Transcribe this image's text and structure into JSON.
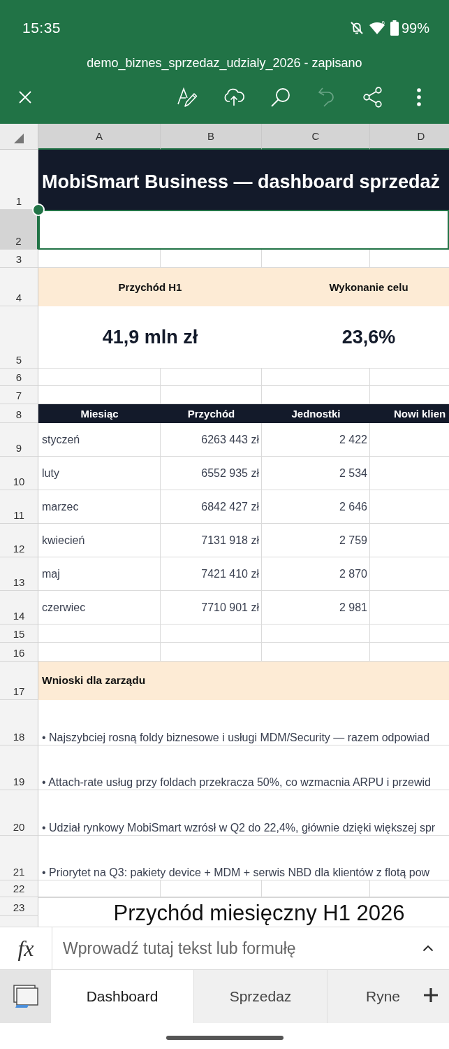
{
  "status_bar": {
    "time": "15:35",
    "wifi_label": "6",
    "battery": "99%"
  },
  "title_bar": {
    "document": "demo_biznes_sprzedaz_udzialy_2026 - zapisano"
  },
  "toolbar": {
    "undo": {
      "disabled": true
    }
  },
  "sheet": {
    "columns": [
      {
        "label": "A",
        "selected": true
      },
      {
        "label": "B",
        "selected": true
      },
      {
        "label": "C",
        "selected": true
      },
      {
        "label": "D",
        "selected": true
      }
    ],
    "rows": [
      {
        "label": "1",
        "selected": false
      },
      {
        "label": "2",
        "selected": true
      },
      {
        "label": "3",
        "selected": false
      },
      {
        "label": "4",
        "selected": false
      },
      {
        "label": "5",
        "selected": false
      },
      {
        "label": "6",
        "selected": false
      },
      {
        "label": "7",
        "selected": false
      },
      {
        "label": "8",
        "selected": false
      },
      {
        "label": "9",
        "selected": false
      },
      {
        "label": "10",
        "selected": false
      },
      {
        "label": "11",
        "selected": false
      },
      {
        "label": "12",
        "selected": false
      },
      {
        "label": "13",
        "selected": false
      },
      {
        "label": "14",
        "selected": false
      },
      {
        "label": "15",
        "selected": false
      },
      {
        "label": "16",
        "selected": false
      },
      {
        "label": "17",
        "selected": false
      },
      {
        "label": "18",
        "selected": false
      },
      {
        "label": "19",
        "selected": false
      },
      {
        "label": "20",
        "selected": false
      },
      {
        "label": "21",
        "selected": false
      },
      {
        "label": "22",
        "selected": false
      },
      {
        "label": "23",
        "selected": false
      }
    ],
    "title": "MobiSmart Business — dashboard sprzedaż",
    "kpis": [
      {
        "label": "Przychód H1",
        "value": "41,9 mln zł"
      },
      {
        "label": "Wykonanie celu",
        "value": "23,6%"
      }
    ],
    "table": {
      "columns": [
        "Miesiąc",
        "Przychód",
        "Jednostki",
        "Nowi klien"
      ],
      "rows": [
        [
          "styczeń",
          "6263 443 zł",
          "2 422"
        ],
        [
          "luty",
          "6552 935 zł",
          "2 534"
        ],
        [
          "marzec",
          "6842 427 zł",
          "2 646"
        ],
        [
          "kwiecień",
          "7131 918 zł",
          "2 759"
        ],
        [
          "maj",
          "7421 410 zł",
          "2 870"
        ],
        [
          "czerwiec",
          "7710 901 zł",
          "2 981"
        ]
      ]
    },
    "notes": {
      "heading": "Wnioski dla zarządu",
      "items": [
        "• Najszybciej rosną foldy biznesowe i usługi MDM/Security — razem odpowiad",
        "• Attach-rate usług przy foldach przekracza 50%, co wzmacnia ARPU i przewid",
        "• Udział rynkowy MobiSmart wzrósł w Q2 do 22,4%, głównie dzięki większej spr",
        "• Priorytet na Q3: pakiety device + MDM + serwis NBD dla klientów z flotą pow"
      ]
    },
    "chart": {
      "title": "Przychód miesięczny H1 2026"
    }
  },
  "formula_bar": {
    "label": "fx",
    "placeholder": "Wprowadź tutaj tekst lub formułę"
  },
  "sheet_tabs": [
    {
      "label": "Dashboard",
      "selected": true
    },
    {
      "label": "Sprzedaz",
      "selected": false
    },
    {
      "label": "Ryne",
      "selected": false
    }
  ]
}
